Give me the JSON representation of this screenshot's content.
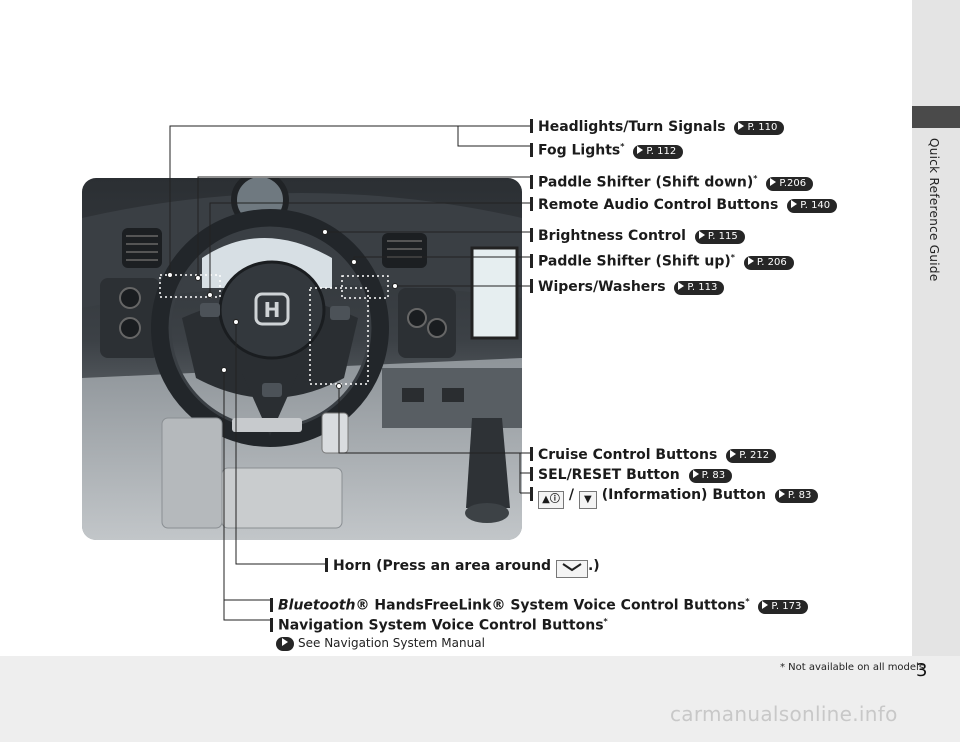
{
  "sidebar": {
    "title": "Quick Reference Guide"
  },
  "page": {
    "number": "3",
    "footnote": "* Not available on all models",
    "watermark": "carmanualsonline.info"
  },
  "callouts": {
    "headlights": {
      "text": "Headlights/Turn Signals",
      "ref": "P. 110"
    },
    "fog": {
      "text": "Fog Lights",
      "star": "*",
      "ref": "P. 112"
    },
    "paddle_down": {
      "text": "Paddle Shifter (Shift down)",
      "star": "*",
      "ref": "P.206"
    },
    "remote_audio": {
      "text": "Remote Audio Control Buttons",
      "ref": "P. 140"
    },
    "brightness": {
      "text": "Brightness Control",
      "ref": "P. 115"
    },
    "paddle_up": {
      "text": "Paddle Shifter (Shift up)",
      "star": "*",
      "ref": "P. 206"
    },
    "wipers": {
      "text": "Wipers/Washers",
      "ref": "P. 113"
    },
    "cruise": {
      "text": "Cruise Control Buttons",
      "ref": "P. 212"
    },
    "sel_reset": {
      "text": "SEL/RESET Button",
      "ref": "P. 83"
    },
    "info": {
      "sep": " / ",
      "text": "(Information) Button",
      "ref": "P. 83"
    },
    "horn": {
      "text_before": "Horn (Press an area around",
      "text_after": ".)"
    },
    "bluetooth": {
      "italic": "Bluetooth",
      "text": "® HandsFreeLink® System Voice Control Buttons",
      "star": "*",
      "ref": "P. 173"
    },
    "navigation": {
      "text": "Navigation System Voice Control Buttons",
      "star": "*",
      "note": "See Navigation System Manual"
    }
  },
  "colors": {
    "sidebar_tab": "#4a4a4a",
    "reference_pill": "#262626",
    "photo_dark": "#2b2f33"
  }
}
